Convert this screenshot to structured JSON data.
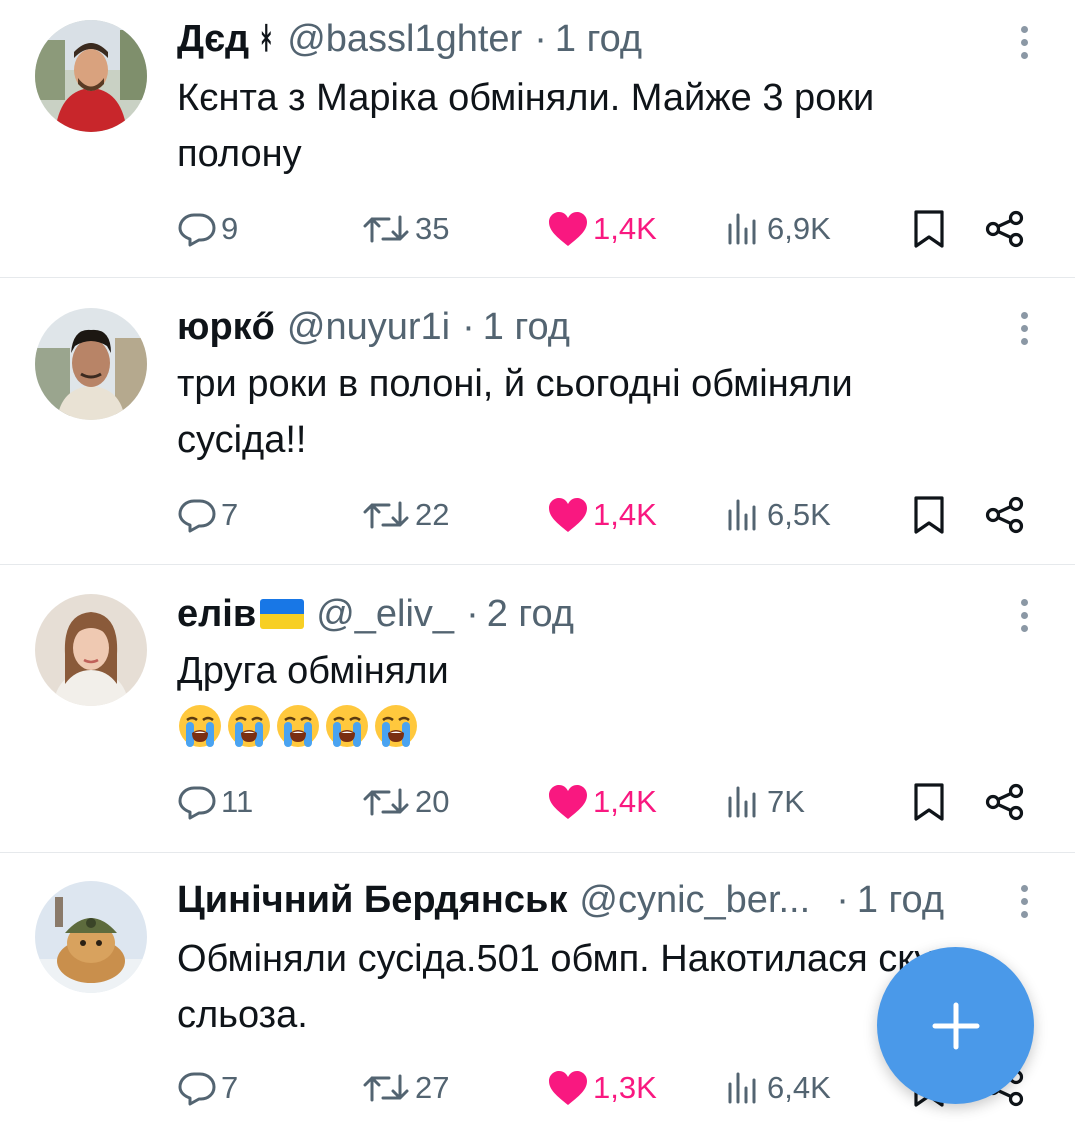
{
  "colors": {
    "text": "#0f1419",
    "secondary": "#536471",
    "like": "#f91880",
    "divider": "#e6e9ec",
    "fab": "#4a99e9"
  },
  "tweets": [
    {
      "name": "Дєд",
      "badge": "ᚼ",
      "handle": "@bassl1ghter",
      "time": "1 год",
      "text": "Кєнта з Маріка обміняли. Майже 3 роки полону",
      "stats": {
        "replies": "9",
        "retweets": "35",
        "likes": "1,4K",
        "views": "6,9K"
      }
    },
    {
      "name": "юркő",
      "handle": "@nuyur1i",
      "time": "1 год",
      "text": "три роки в полоні, й сьогодні обміняли сусіда!!",
      "stats": {
        "replies": "7",
        "retweets": "22",
        "likes": "1,4K",
        "views": "6,5K"
      }
    },
    {
      "name": "елів",
      "flag": "ukraine-flag",
      "handle": "@_eliv_",
      "time": "2 год",
      "text": "Друга обміняли",
      "emoji": "loudly-crying-face",
      "emoji_count": 5,
      "stats": {
        "replies": "11",
        "retweets": "20",
        "likes": "1,4K",
        "views": "7K"
      }
    },
    {
      "name": "Цинічний Бердянськ",
      "handle": "@cynic_ber...",
      "time": "1 год",
      "text": "Обміняли сусіда.501 обмп. Накотилася скупа сльоза.",
      "stats": {
        "replies": "7",
        "retweets": "27",
        "likes": "1,3K",
        "views": "6,4K"
      }
    }
  ],
  "icons": {
    "reply": "reply-icon",
    "retweet": "retweet-icon",
    "like": "heart-icon",
    "views": "views-icon",
    "bookmark": "bookmark-icon",
    "share": "share-icon",
    "more": "more-vertical-icon",
    "compose": "plus-icon"
  }
}
